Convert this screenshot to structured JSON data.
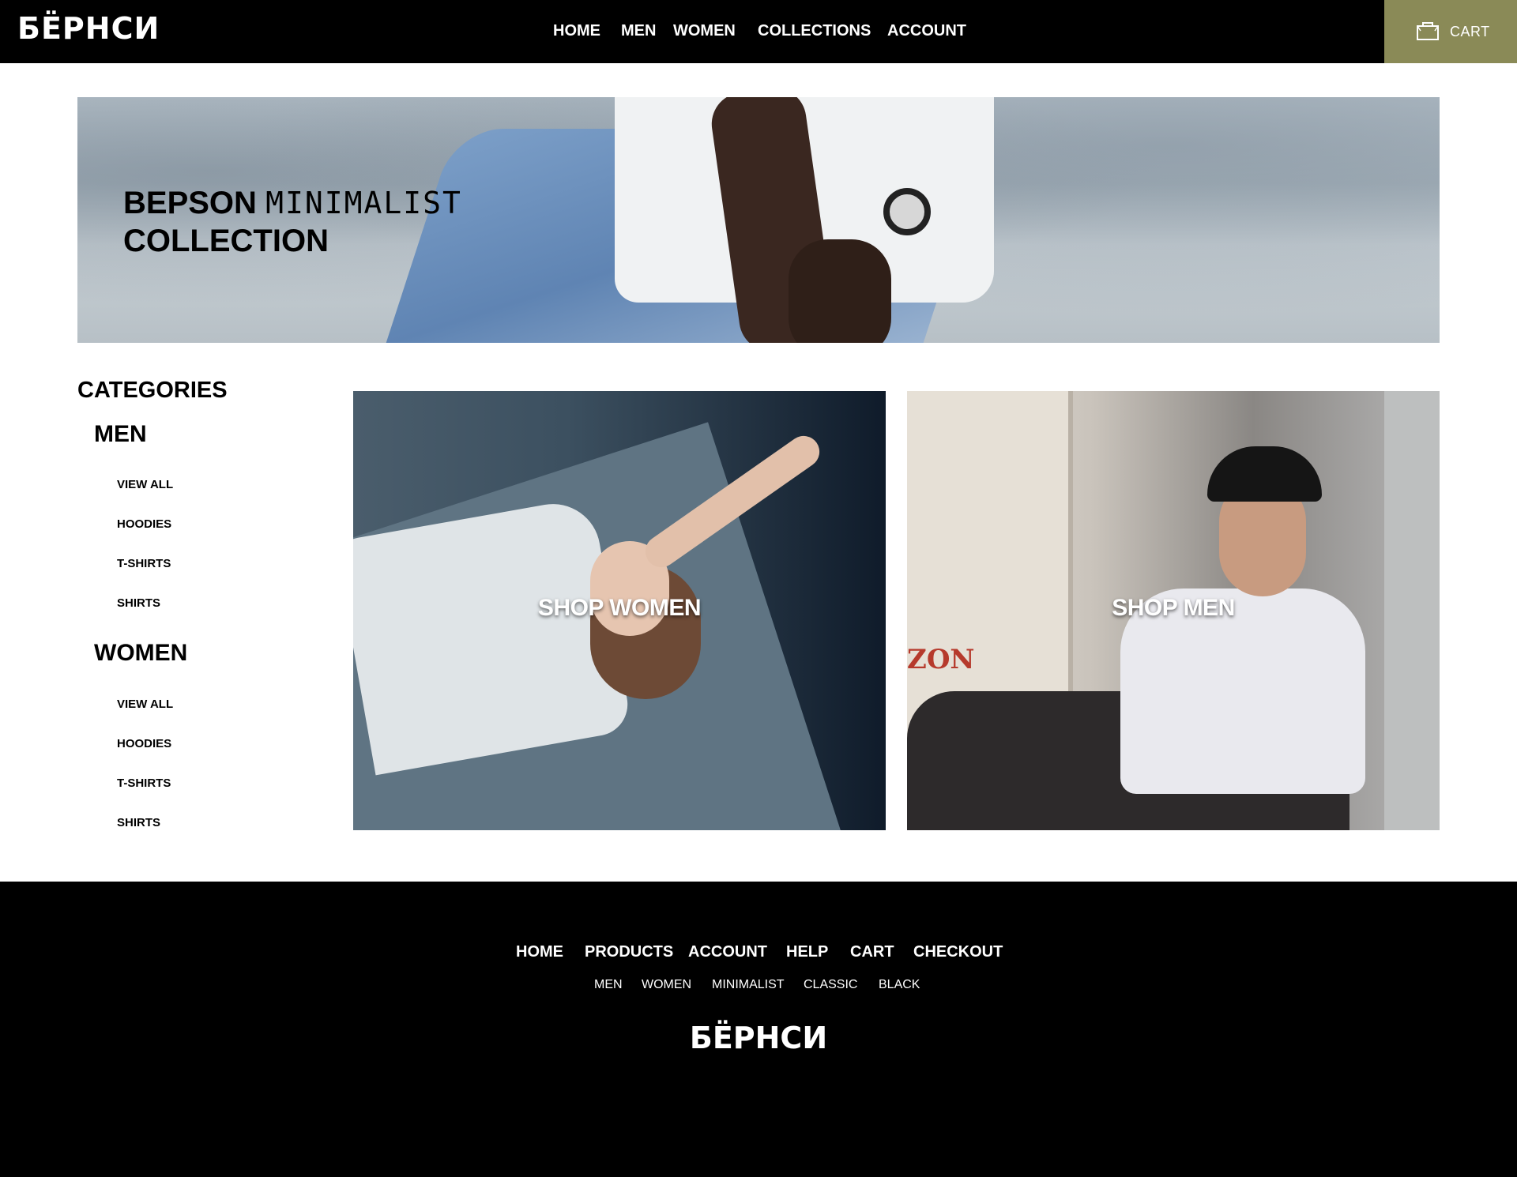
{
  "header": {
    "logo": "БЁРНСИ",
    "nav": [
      "HOME",
      "MEN",
      "WOMEN",
      "COLLECTIONS",
      "ACCOUNT"
    ],
    "cart_label": "CART",
    "cart_icon": "shopping-bag-icon",
    "cart_bg": "#8a8a57"
  },
  "hero": {
    "brand": "BEPSON",
    "subtitle": "MINIMALIST",
    "line2": "COLLECTION"
  },
  "categories": {
    "heading": "CATEGORIES",
    "groups": [
      {
        "title": "MEN",
        "links": [
          "VIEW ALL",
          "HOODIES",
          "T-SHIRTS",
          "SHIRTS"
        ]
      },
      {
        "title": "WOMEN",
        "links": [
          "VIEW ALL",
          "HOODIES",
          "T-SHIRTS",
          "SHIRTS"
        ]
      }
    ]
  },
  "tiles": {
    "women": "SHOP WOMEN",
    "men": "SHOP MEN",
    "men_sign": "ZON"
  },
  "footer": {
    "nav": [
      "HOME",
      "PRODUCTS",
      "ACCOUNT",
      "HELP",
      "CART",
      "CHECKOUT"
    ],
    "sub": [
      "MEN",
      "WOMEN",
      "MINIMALIST",
      "CLASSIC",
      "BLACK"
    ],
    "logo": "БЁРНСИ"
  }
}
